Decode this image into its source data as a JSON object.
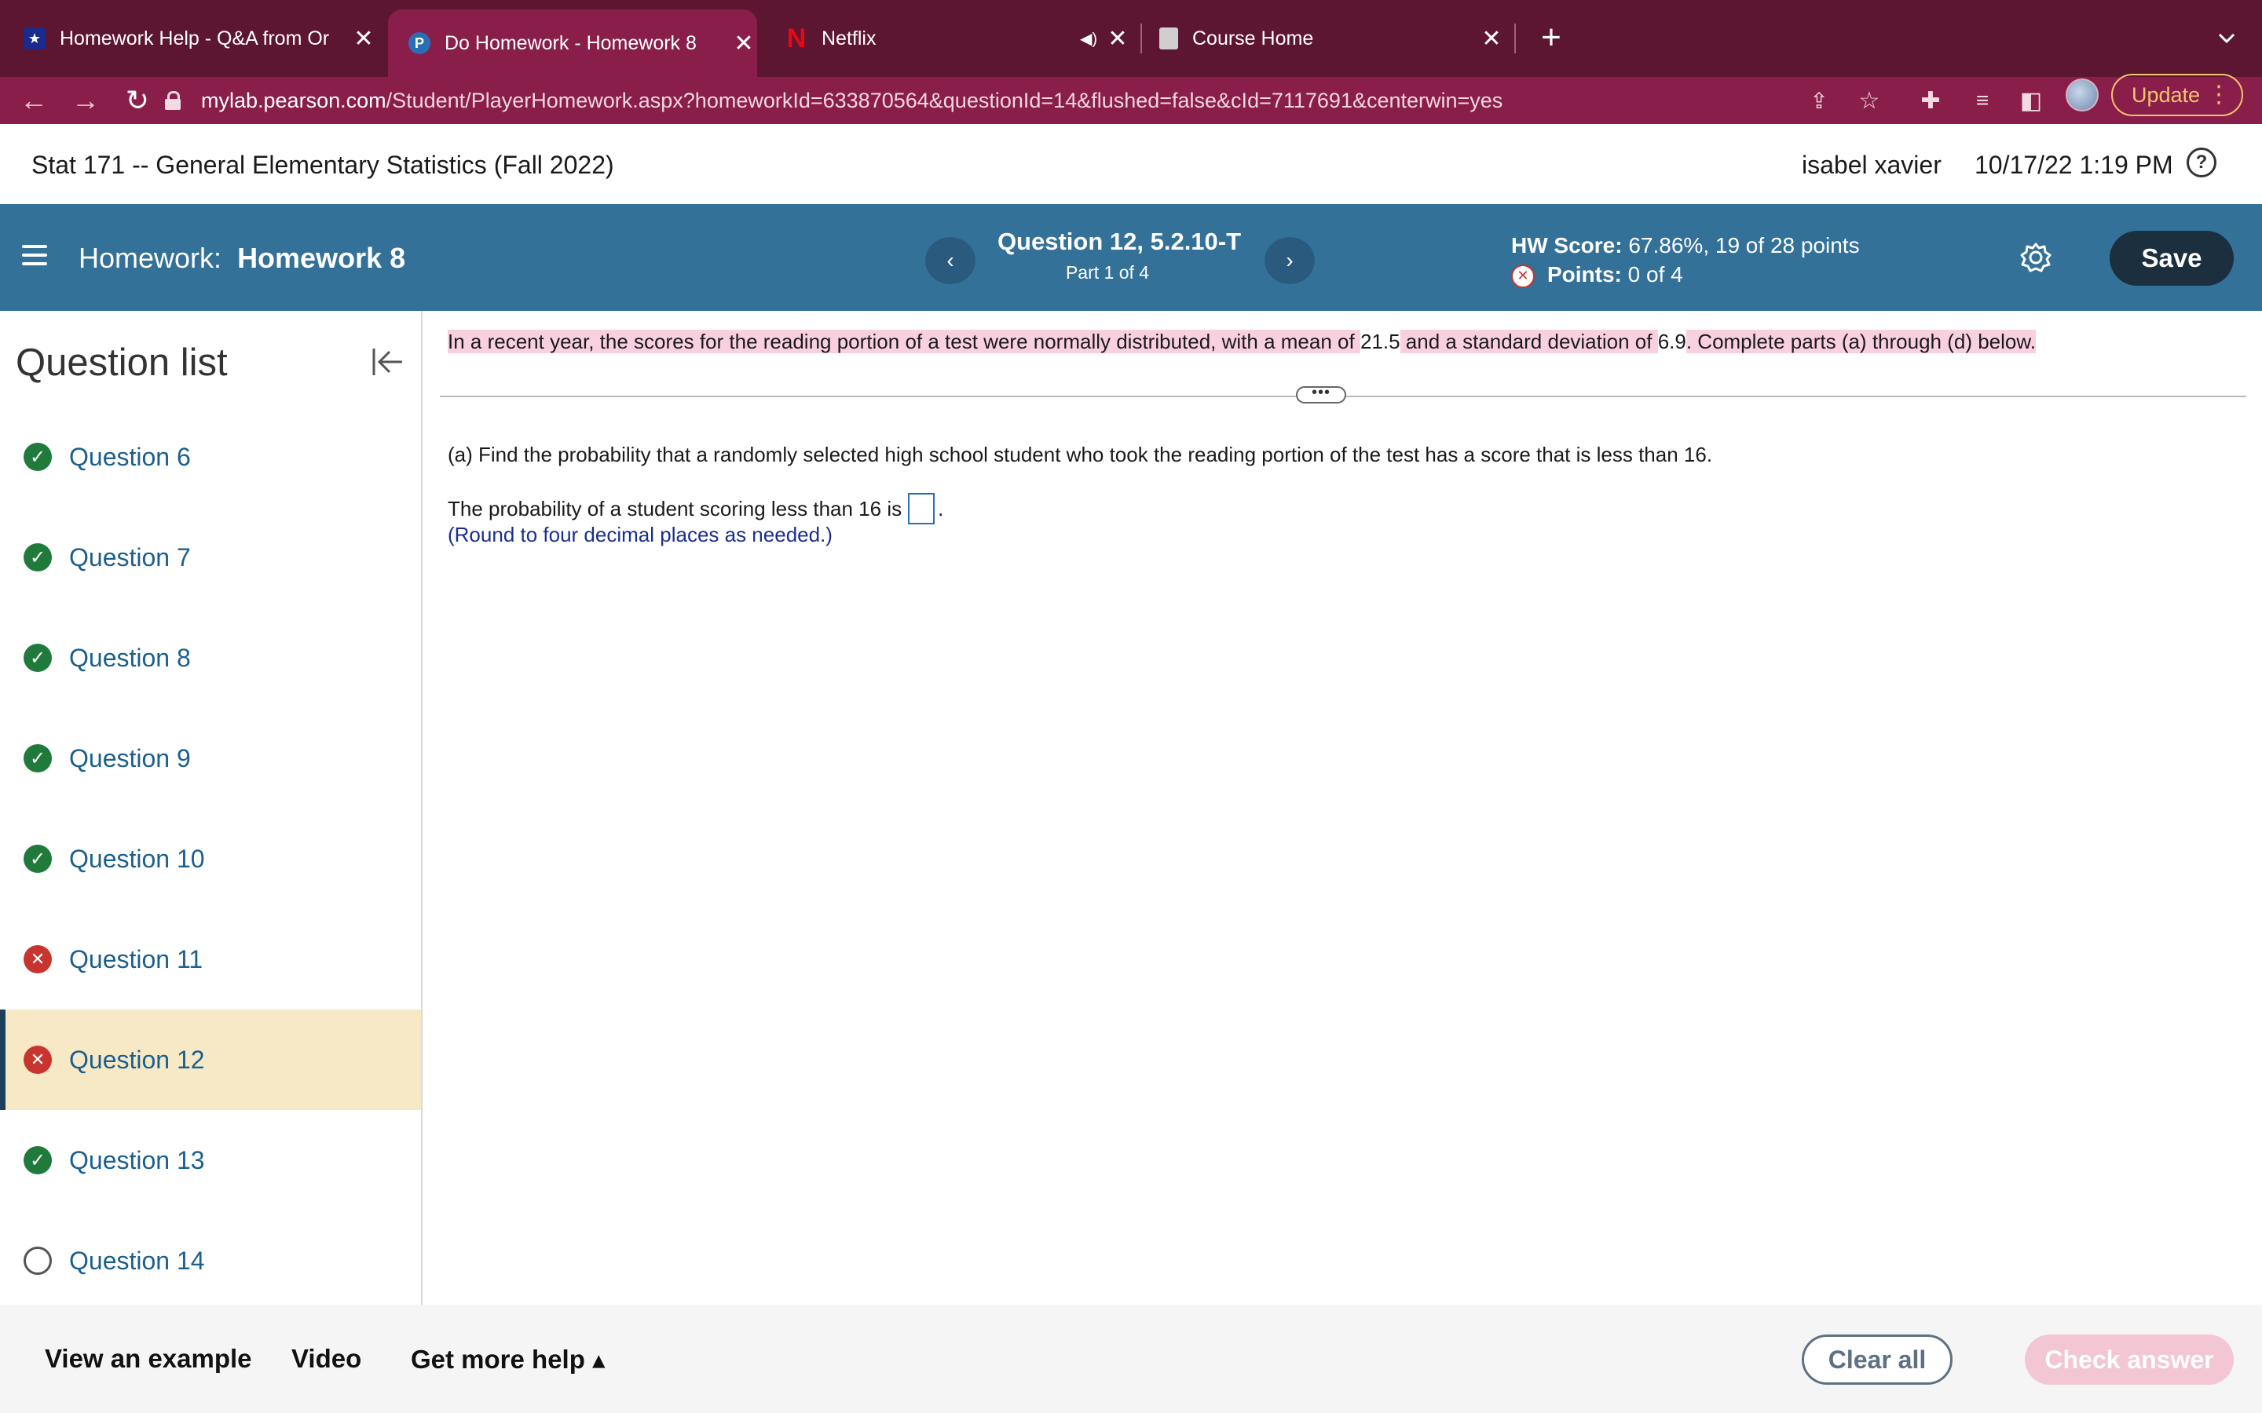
{
  "browser": {
    "tabs": [
      {
        "title": "Homework Help - Q&A from Or",
        "icon": "star-icon",
        "active": false
      },
      {
        "title": "Do Homework - Homework 8",
        "icon": "pearson-icon",
        "active": true
      },
      {
        "title": "Netflix",
        "icon": "netflix-icon",
        "active": false
      },
      {
        "title": "Course Home",
        "icon": "page-icon",
        "active": false
      }
    ],
    "url_host": "mylab.pearson.com",
    "url_path": "/Student/PlayerHomework.aspx?homeworkId=633870564&questionId=14&flushed=false&cId=7117691&centerwin=yes",
    "update_label": "Update"
  },
  "course": {
    "title": "Stat 171 -- General Elementary Statistics (Fall 2022)",
    "user": "isabel xavier",
    "datetime": "10/17/22 1:19 PM",
    "help_glyph": "?"
  },
  "homework": {
    "prefix": "Homework:",
    "name": "Homework 8",
    "question_label": "Question 12, 5.2.10-T",
    "part_label": "Part 1 of 4",
    "hw_score_label": "HW Score:",
    "hw_score_value": "67.86%, 19 of 28 points",
    "points_label": "Points:",
    "points_value": "0 of 4",
    "save_label": "Save",
    "prev_glyph": "‹",
    "next_glyph": "›"
  },
  "sidebar": {
    "title": "Question list",
    "items": [
      {
        "label": "Question 6",
        "status": "correct"
      },
      {
        "label": "Question 7",
        "status": "correct"
      },
      {
        "label": "Question 8",
        "status": "correct"
      },
      {
        "label": "Question 9",
        "status": "correct"
      },
      {
        "label": "Question 10",
        "status": "correct"
      },
      {
        "label": "Question 11",
        "status": "wrong"
      },
      {
        "label": "Question 12",
        "status": "wrong",
        "current": true
      },
      {
        "label": "Question 13",
        "status": "correct"
      },
      {
        "label": "Question 14",
        "status": "open"
      }
    ]
  },
  "question": {
    "stem_1": "In a recent year, the scores for the reading portion of a test were normally distributed, with a mean of ",
    "mean": "21.5",
    "stem_2": " and a standard deviation of ",
    "sd": "6.9",
    "stem_3": ". Complete parts (a) through (d) below.",
    "part_a": "(a) Find the probability that a randomly selected high school student who took the reading portion of the test has a score that is less than 16.",
    "prob_prefix": "The probability of a student scoring less than 16 is",
    "prob_suffix": ".",
    "round_note": "(Round to four decimal places as needed.)",
    "divider_glyph": "•••"
  },
  "footer": {
    "view_example": "View an example",
    "video": "Video",
    "more_help": "Get more help ▴",
    "clear_all": "Clear all",
    "check_answer": "Check answer"
  },
  "colors": {
    "tabstrip": "#5d1632",
    "addressbar": "#8a1e4b",
    "hw_bar": "#347199",
    "current_question_bg": "#f8e9c6",
    "highlight": "#f9d0e0",
    "correct": "#1f7a3b",
    "wrong": "#c8352e"
  }
}
